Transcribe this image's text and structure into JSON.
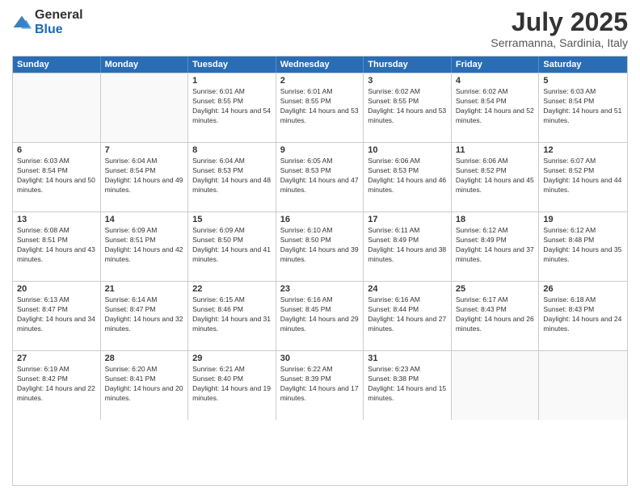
{
  "logo": {
    "general": "General",
    "blue": "Blue"
  },
  "title": "July 2025",
  "location": "Serramanna, Sardinia, Italy",
  "days_header": [
    "Sunday",
    "Monday",
    "Tuesday",
    "Wednesday",
    "Thursday",
    "Friday",
    "Saturday"
  ],
  "weeks": [
    [
      {
        "day": "",
        "info": ""
      },
      {
        "day": "",
        "info": ""
      },
      {
        "day": "1",
        "info": "Sunrise: 6:01 AM\nSunset: 8:55 PM\nDaylight: 14 hours and 54 minutes."
      },
      {
        "day": "2",
        "info": "Sunrise: 6:01 AM\nSunset: 8:55 PM\nDaylight: 14 hours and 53 minutes."
      },
      {
        "day": "3",
        "info": "Sunrise: 6:02 AM\nSunset: 8:55 PM\nDaylight: 14 hours and 53 minutes."
      },
      {
        "day": "4",
        "info": "Sunrise: 6:02 AM\nSunset: 8:54 PM\nDaylight: 14 hours and 52 minutes."
      },
      {
        "day": "5",
        "info": "Sunrise: 6:03 AM\nSunset: 8:54 PM\nDaylight: 14 hours and 51 minutes."
      }
    ],
    [
      {
        "day": "6",
        "info": "Sunrise: 6:03 AM\nSunset: 8:54 PM\nDaylight: 14 hours and 50 minutes."
      },
      {
        "day": "7",
        "info": "Sunrise: 6:04 AM\nSunset: 8:54 PM\nDaylight: 14 hours and 49 minutes."
      },
      {
        "day": "8",
        "info": "Sunrise: 6:04 AM\nSunset: 8:53 PM\nDaylight: 14 hours and 48 minutes."
      },
      {
        "day": "9",
        "info": "Sunrise: 6:05 AM\nSunset: 8:53 PM\nDaylight: 14 hours and 47 minutes."
      },
      {
        "day": "10",
        "info": "Sunrise: 6:06 AM\nSunset: 8:53 PM\nDaylight: 14 hours and 46 minutes."
      },
      {
        "day": "11",
        "info": "Sunrise: 6:06 AM\nSunset: 8:52 PM\nDaylight: 14 hours and 45 minutes."
      },
      {
        "day": "12",
        "info": "Sunrise: 6:07 AM\nSunset: 8:52 PM\nDaylight: 14 hours and 44 minutes."
      }
    ],
    [
      {
        "day": "13",
        "info": "Sunrise: 6:08 AM\nSunset: 8:51 PM\nDaylight: 14 hours and 43 minutes."
      },
      {
        "day": "14",
        "info": "Sunrise: 6:09 AM\nSunset: 8:51 PM\nDaylight: 14 hours and 42 minutes."
      },
      {
        "day": "15",
        "info": "Sunrise: 6:09 AM\nSunset: 8:50 PM\nDaylight: 14 hours and 41 minutes."
      },
      {
        "day": "16",
        "info": "Sunrise: 6:10 AM\nSunset: 8:50 PM\nDaylight: 14 hours and 39 minutes."
      },
      {
        "day": "17",
        "info": "Sunrise: 6:11 AM\nSunset: 8:49 PM\nDaylight: 14 hours and 38 minutes."
      },
      {
        "day": "18",
        "info": "Sunrise: 6:12 AM\nSunset: 8:49 PM\nDaylight: 14 hours and 37 minutes."
      },
      {
        "day": "19",
        "info": "Sunrise: 6:12 AM\nSunset: 8:48 PM\nDaylight: 14 hours and 35 minutes."
      }
    ],
    [
      {
        "day": "20",
        "info": "Sunrise: 6:13 AM\nSunset: 8:47 PM\nDaylight: 14 hours and 34 minutes."
      },
      {
        "day": "21",
        "info": "Sunrise: 6:14 AM\nSunset: 8:47 PM\nDaylight: 14 hours and 32 minutes."
      },
      {
        "day": "22",
        "info": "Sunrise: 6:15 AM\nSunset: 8:46 PM\nDaylight: 14 hours and 31 minutes."
      },
      {
        "day": "23",
        "info": "Sunrise: 6:16 AM\nSunset: 8:45 PM\nDaylight: 14 hours and 29 minutes."
      },
      {
        "day": "24",
        "info": "Sunrise: 6:16 AM\nSunset: 8:44 PM\nDaylight: 14 hours and 27 minutes."
      },
      {
        "day": "25",
        "info": "Sunrise: 6:17 AM\nSunset: 8:43 PM\nDaylight: 14 hours and 26 minutes."
      },
      {
        "day": "26",
        "info": "Sunrise: 6:18 AM\nSunset: 8:43 PM\nDaylight: 14 hours and 24 minutes."
      }
    ],
    [
      {
        "day": "27",
        "info": "Sunrise: 6:19 AM\nSunset: 8:42 PM\nDaylight: 14 hours and 22 minutes."
      },
      {
        "day": "28",
        "info": "Sunrise: 6:20 AM\nSunset: 8:41 PM\nDaylight: 14 hours and 20 minutes."
      },
      {
        "day": "29",
        "info": "Sunrise: 6:21 AM\nSunset: 8:40 PM\nDaylight: 14 hours and 19 minutes."
      },
      {
        "day": "30",
        "info": "Sunrise: 6:22 AM\nSunset: 8:39 PM\nDaylight: 14 hours and 17 minutes."
      },
      {
        "day": "31",
        "info": "Sunrise: 6:23 AM\nSunset: 8:38 PM\nDaylight: 14 hours and 15 minutes."
      },
      {
        "day": "",
        "info": ""
      },
      {
        "day": "",
        "info": ""
      }
    ]
  ]
}
